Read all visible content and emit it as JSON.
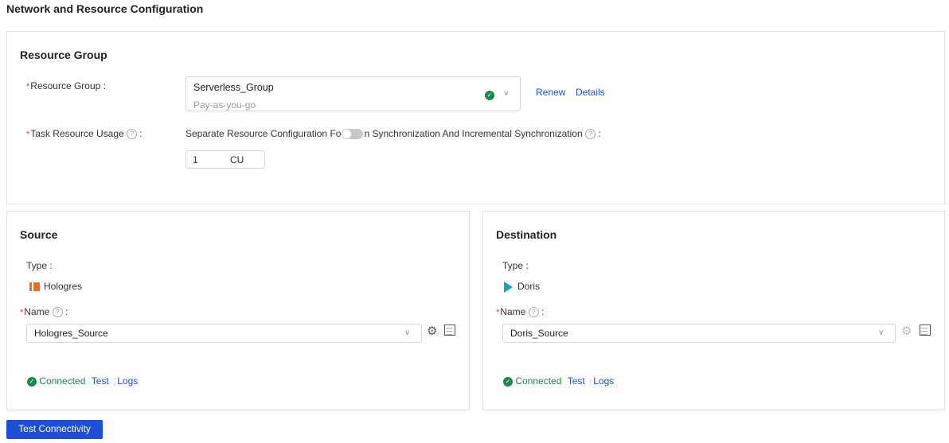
{
  "page_title": "Network and Resource Configuration",
  "resource_group": {
    "heading": "Resource Group",
    "group_label": "Resource Group",
    "group_value": "Serverless_Group",
    "group_sub": "Pay-as-you-go",
    "renew": "Renew",
    "details": "Details",
    "usage_label": "Task Resource Usage",
    "separate_text_a": "Separate Resource Configuration Fo",
    "separate_text_b": "n Synchronization And Incremental Synchronization",
    "separate_toggle_on": false,
    "cu_value": "1",
    "cu_unit": "CU",
    "colon": ":"
  },
  "source": {
    "heading": "Source",
    "type_label": "Type",
    "type_value": "Hologres",
    "name_label": "Name",
    "name_value": "Hologres_Source",
    "status": "Connected",
    "test": "Test",
    "logs": "Logs"
  },
  "destination": {
    "heading": "Destination",
    "type_label": "Type",
    "type_value": "Doris",
    "name_label": "Name",
    "name_value": "Doris_Source",
    "status": "Connected",
    "test": "Test",
    "logs": "Logs"
  },
  "test_connectivity": "Test Connectivity",
  "colors": {
    "accent": "#1f4fd6",
    "success": "#1a8a4a",
    "required": "#e53935",
    "hologres": "#f26b1d",
    "doris": "#1aa3b5"
  }
}
